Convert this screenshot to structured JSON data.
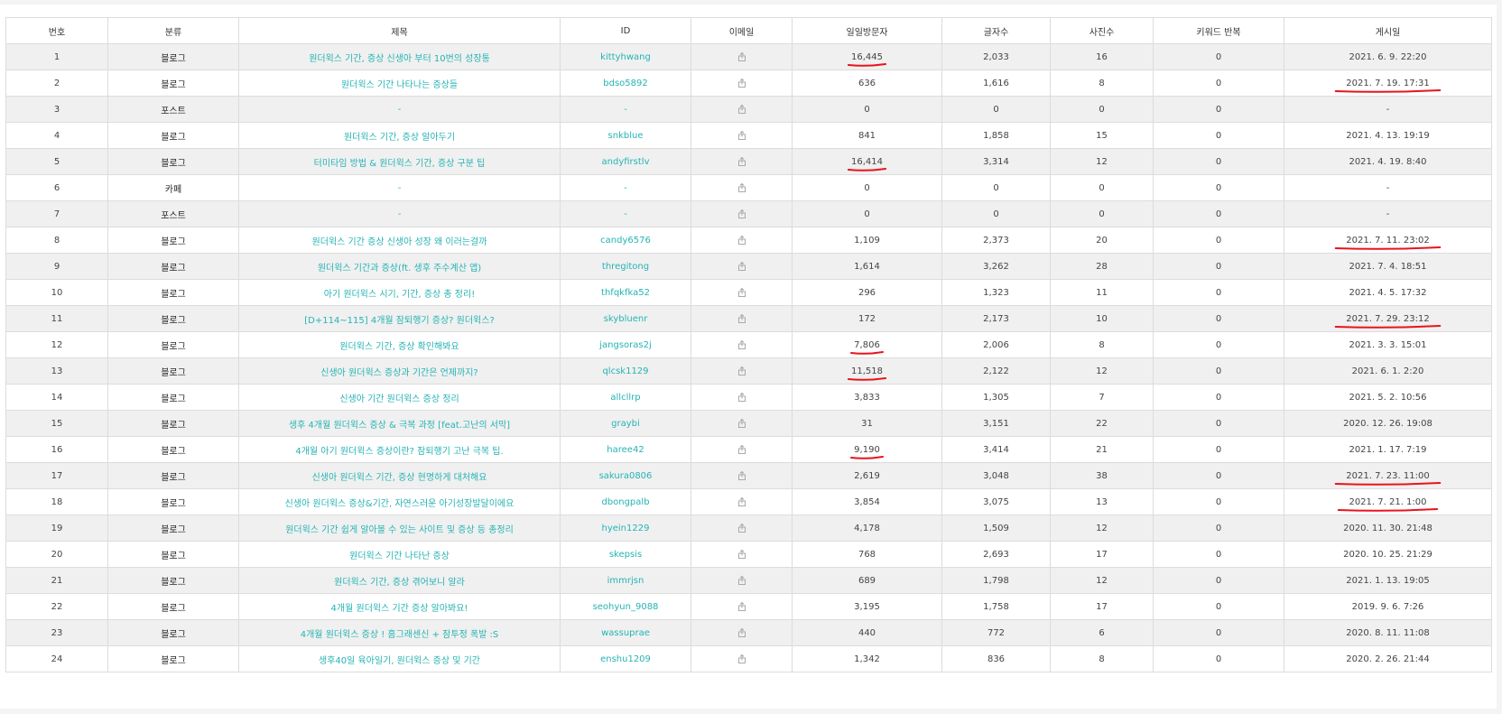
{
  "table": {
    "headers": [
      "번호",
      "분류",
      "제목",
      "ID",
      "이메일",
      "일일방문자",
      "글자수",
      "사진수",
      "키워드 반복",
      "게시일"
    ],
    "email_icon": "share-icon",
    "rows": [
      {
        "no": "1",
        "cat": "블로그",
        "title": "원더윅스 기간, 증상 신생아 부터 10번의 성장통",
        "id": "kittyhwang",
        "visitors": "16,445",
        "chars": "2,033",
        "photos": "16",
        "keywords": "0",
        "date": "2021. 6. 9. 22:20"
      },
      {
        "no": "2",
        "cat": "블로그",
        "title": "원더윅스 기간 나타나는 증상들",
        "id": "bdso5892",
        "visitors": "636",
        "chars": "1,616",
        "photos": "8",
        "keywords": "0",
        "date": "2021. 7. 19. 17:31"
      },
      {
        "no": "3",
        "cat": "포스트",
        "title": "-",
        "id": "-",
        "visitors": "0",
        "chars": "0",
        "photos": "0",
        "keywords": "0",
        "date": "-"
      },
      {
        "no": "4",
        "cat": "블로그",
        "title": "원더윅스 기간, 증상 알아두기",
        "id": "snkblue",
        "visitors": "841",
        "chars": "1,858",
        "photos": "15",
        "keywords": "0",
        "date": "2021. 4. 13. 19:19"
      },
      {
        "no": "5",
        "cat": "블로그",
        "title": "터미타임 방법 & 원더윅스 기간, 증상 구분 팁",
        "id": "andyfirstlv",
        "visitors": "16,414",
        "chars": "3,314",
        "photos": "12",
        "keywords": "0",
        "date": "2021. 4. 19. 8:40"
      },
      {
        "no": "6",
        "cat": "카페",
        "title": "-",
        "id": "-",
        "visitors": "0",
        "chars": "0",
        "photos": "0",
        "keywords": "0",
        "date": "-"
      },
      {
        "no": "7",
        "cat": "포스트",
        "title": "-",
        "id": "-",
        "visitors": "0",
        "chars": "0",
        "photos": "0",
        "keywords": "0",
        "date": "-"
      },
      {
        "no": "8",
        "cat": "블로그",
        "title": "원더윅스 기간 증상 신생아 성장 왜 이러는걸까",
        "id": "candy6576",
        "visitors": "1,109",
        "chars": "2,373",
        "photos": "20",
        "keywords": "0",
        "date": "2021. 7. 11. 23:02"
      },
      {
        "no": "9",
        "cat": "블로그",
        "title": "원더윅스 기간과 증상(ft. 생후 주수계산 앱)",
        "id": "thregitong",
        "visitors": "1,614",
        "chars": "3,262",
        "photos": "28",
        "keywords": "0",
        "date": "2021. 7. 4. 18:51"
      },
      {
        "no": "10",
        "cat": "블로그",
        "title": "아기 원더윅스 시기, 기간, 증상 총 정리!",
        "id": "thfqkfka52",
        "visitors": "296",
        "chars": "1,323",
        "photos": "11",
        "keywords": "0",
        "date": "2021. 4. 5. 17:32"
      },
      {
        "no": "11",
        "cat": "블로그",
        "title": "[D+114~115] 4개월 잠퇴행기 증상? 원더윅스?",
        "id": "skybluenr",
        "visitors": "172",
        "chars": "2,173",
        "photos": "10",
        "keywords": "0",
        "date": "2021. 7. 29. 23:12"
      },
      {
        "no": "12",
        "cat": "블로그",
        "title": "원더윅스 기간, 증상 확인해봐요",
        "id": "jangsoras2j",
        "visitors": "7,806",
        "chars": "2,006",
        "photos": "8",
        "keywords": "0",
        "date": "2021. 3. 3. 15:01"
      },
      {
        "no": "13",
        "cat": "블로그",
        "title": "신생아 원더윅스 증상과 기간은 언제까지?",
        "id": "qlcsk1129",
        "visitors": "11,518",
        "chars": "2,122",
        "photos": "12",
        "keywords": "0",
        "date": "2021. 6. 1. 2:20"
      },
      {
        "no": "14",
        "cat": "블로그",
        "title": "신생아 기간 원더윅스 증상 정리",
        "id": "allcllrp",
        "visitors": "3,833",
        "chars": "1,305",
        "photos": "7",
        "keywords": "0",
        "date": "2021. 5. 2. 10:56"
      },
      {
        "no": "15",
        "cat": "블로그",
        "title": "생후 4개월 원더윅스 증상 & 극복 과정 [feat.고난의 서막]",
        "id": "graybi",
        "visitors": "31",
        "chars": "3,151",
        "photos": "22",
        "keywords": "0",
        "date": "2020. 12. 26. 19:08"
      },
      {
        "no": "16",
        "cat": "블로그",
        "title": "4개월 아기 원더윅스 증상이란? 잠퇴행기 고난 극복 팁.",
        "id": "haree42",
        "visitors": "9,190",
        "chars": "3,414",
        "photos": "21",
        "keywords": "0",
        "date": "2021. 1. 17. 7:19"
      },
      {
        "no": "17",
        "cat": "블로그",
        "title": "신생아 원더윅스 기간, 증상 현명하게 대처해요",
        "id": "sakura0806",
        "visitors": "2,619",
        "chars": "3,048",
        "photos": "38",
        "keywords": "0",
        "date": "2021. 7. 23. 11:00"
      },
      {
        "no": "18",
        "cat": "블로그",
        "title": "신생아 원더윅스 증상&기간, 자연스러운 아기성장발달이에요",
        "id": "dbongpalb",
        "visitors": "3,854",
        "chars": "3,075",
        "photos": "13",
        "keywords": "0",
        "date": "2021. 7. 21. 1:00"
      },
      {
        "no": "19",
        "cat": "블로그",
        "title": "원더윅스 기간 쉽게 알아볼 수 있는 사이트 및 증상 등 총정리",
        "id": "hyein1229",
        "visitors": "4,178",
        "chars": "1,509",
        "photos": "12",
        "keywords": "0",
        "date": "2020. 11. 30. 21:48"
      },
      {
        "no": "20",
        "cat": "블로그",
        "title": "원더윅스 기간 나타난 증상",
        "id": "skepsis",
        "visitors": "768",
        "chars": "2,693",
        "photos": "17",
        "keywords": "0",
        "date": "2020. 10. 25. 21:29"
      },
      {
        "no": "21",
        "cat": "블로그",
        "title": "원더윅스 기간, 증상 겪어보니 알라",
        "id": "immrjsn",
        "visitors": "689",
        "chars": "1,798",
        "photos": "12",
        "keywords": "0",
        "date": "2021. 1. 13. 19:05"
      },
      {
        "no": "22",
        "cat": "블로그",
        "title": "4개월 원더윅스 기간 증상 알아봐요!",
        "id": "seohyun_9088",
        "visitors": "3,195",
        "chars": "1,758",
        "photos": "17",
        "keywords": "0",
        "date": "2019. 9. 6. 7:26"
      },
      {
        "no": "23",
        "cat": "블로그",
        "title": "4개월 원더윅스 증상 ! 홈그래센신 + 잠투정 폭발 :S",
        "id": "wassuprae",
        "visitors": "440",
        "chars": "772",
        "photos": "6",
        "keywords": "0",
        "date": "2020. 8. 11. 11:08"
      },
      {
        "no": "24",
        "cat": "블로그",
        "title": "생후40일 육아일기, 원더윅스 증상 및 기간",
        "id": "enshu1209",
        "visitors": "1,342",
        "chars": "836",
        "photos": "8",
        "keywords": "0",
        "date": "2020. 2. 26. 21:44"
      }
    ]
  },
  "annotations": {
    "color": "#e8141c",
    "underlined_visitors_rows": [
      1,
      5,
      12,
      13,
      16
    ],
    "underlined_date_rows": [
      2,
      8,
      11,
      17,
      18
    ]
  }
}
